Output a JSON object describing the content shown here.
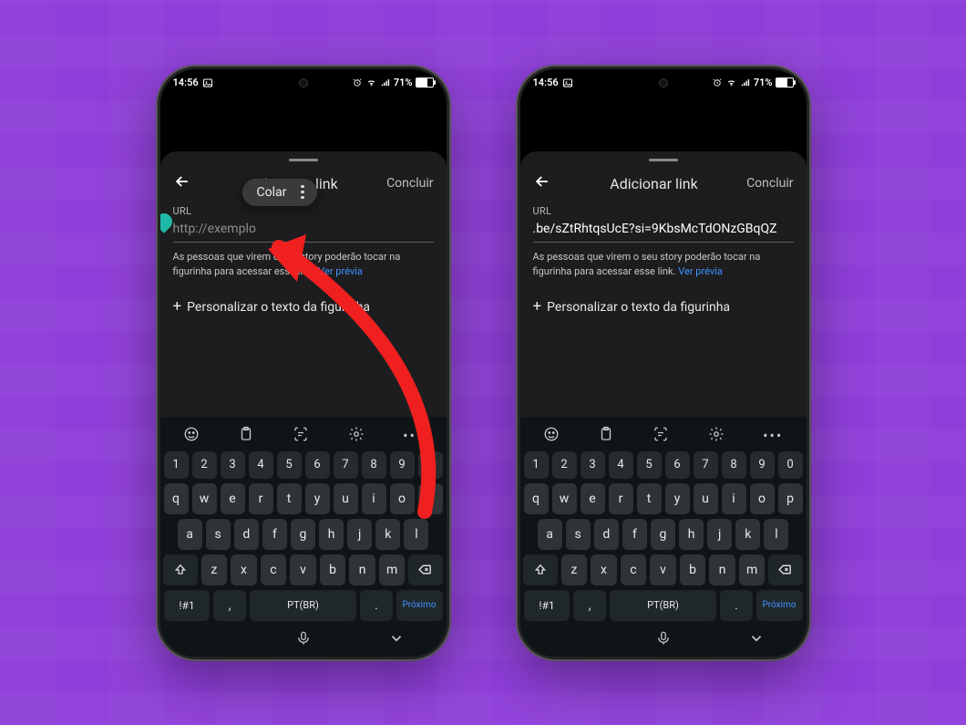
{
  "status": {
    "time": "14:56",
    "battery_text": "71%"
  },
  "sheet": {
    "title": "Adicionar link",
    "done_label": "Concluir",
    "field_label": "URL",
    "placeholder": "http://exemplo",
    "filled_value": ".be/sZtRhtqsUcE?si=9KbsMcTdONzGBqQZ",
    "helper_text": "As pessoas que virem o seu story poderão tocar na figurinha para acessar esse link.",
    "helper_link": "Ver prévia",
    "customize_label": "Personalizar o texto da figurinha"
  },
  "popup": {
    "paste_label": "Colar"
  },
  "keyboard": {
    "row_num": [
      "1",
      "2",
      "3",
      "4",
      "5",
      "6",
      "7",
      "8",
      "9",
      "0"
    ],
    "row1": [
      "q",
      "w",
      "e",
      "r",
      "t",
      "y",
      "u",
      "i",
      "o",
      "p"
    ],
    "row2": [
      "a",
      "s",
      "d",
      "f",
      "g",
      "h",
      "j",
      "k",
      "l"
    ],
    "row3": [
      "z",
      "x",
      "c",
      "v",
      "b",
      "n",
      "m"
    ],
    "sym_label": "!#1",
    "lang_label": "PT(BR)",
    "next_label": "Próximo",
    "period_label": ".",
    "comma_label": ","
  }
}
